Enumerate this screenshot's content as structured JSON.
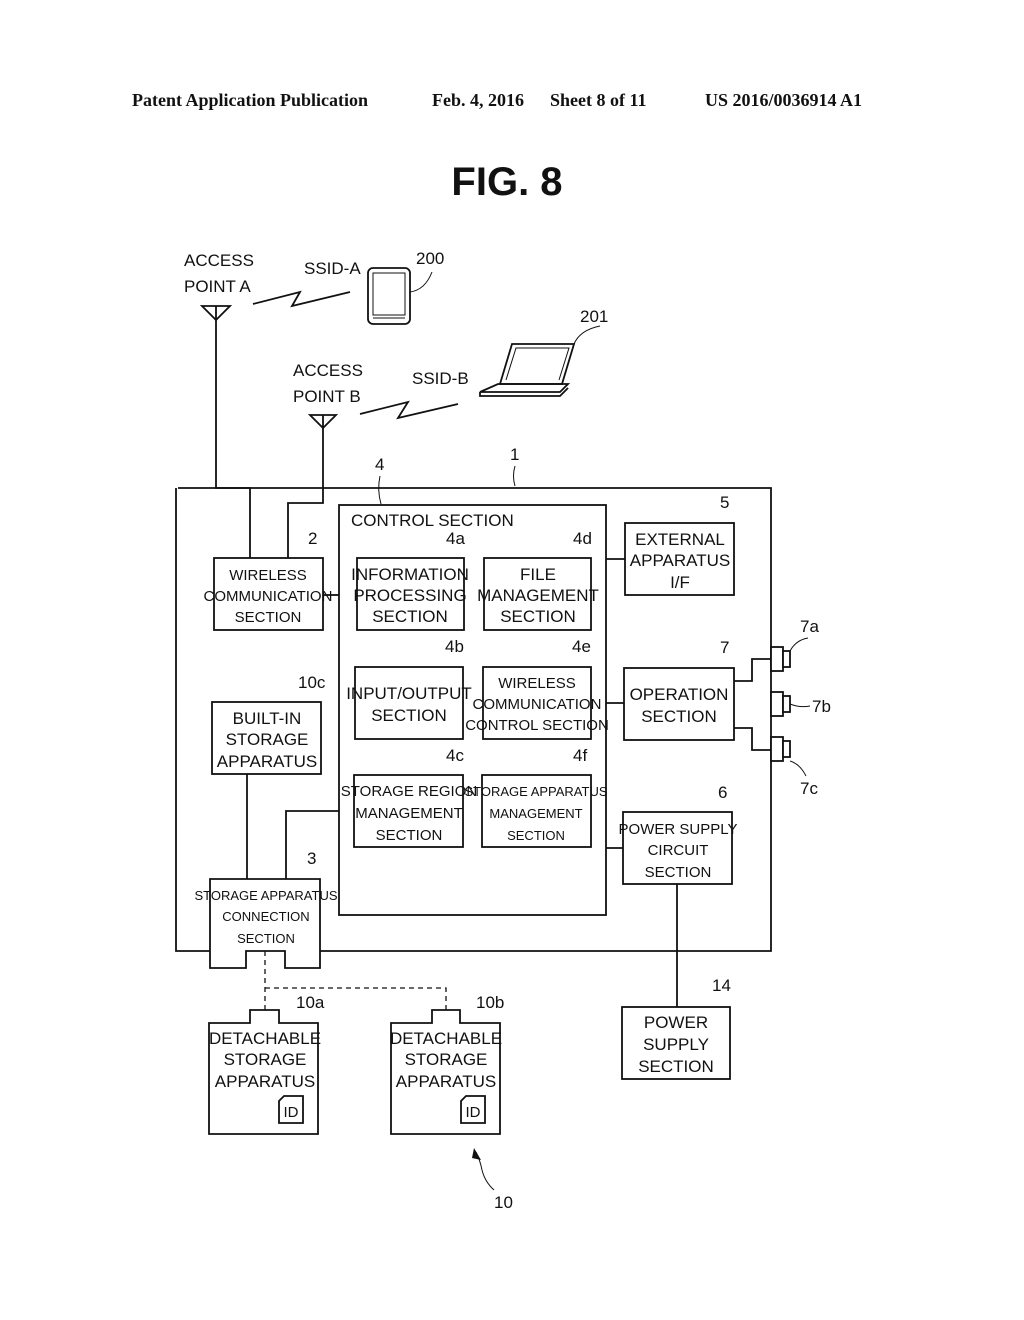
{
  "header": {
    "publication": "Patent Application Publication",
    "date": "Feb. 4, 2016",
    "sheet": "Sheet 8 of 11",
    "patent_number": "US 2016/0036914 A1"
  },
  "figure_title": "FIG. 8",
  "external": {
    "access_point_a": [
      "ACCESS",
      "POINT A"
    ],
    "access_point_b": [
      "ACCESS",
      "POINT B"
    ],
    "ssid_a": "SSID-A",
    "ssid_b": "SSID-B",
    "tablet_ref": "200",
    "laptop_ref": "201"
  },
  "device": {
    "ref": "1",
    "control_section": {
      "ref": "4",
      "title": "CONTROL SECTION",
      "blocks": [
        {
          "ref": "4a",
          "lines": [
            "INFORMATION",
            "PROCESSING",
            "SECTION"
          ]
        },
        {
          "ref": "4d",
          "lines": [
            "FILE",
            "MANAGEMENT",
            "SECTION"
          ]
        },
        {
          "ref": "4b",
          "lines": [
            "INPUT/OUTPUT",
            "SECTION"
          ]
        },
        {
          "ref": "4e",
          "lines": [
            "WIRELESS",
            "COMMUNICATION",
            "CONTROL SECTION"
          ]
        },
        {
          "ref": "4c",
          "lines": [
            "STORAGE REGION",
            "MANAGEMENT",
            "SECTION"
          ]
        },
        {
          "ref": "4f",
          "lines": [
            "STORAGE APPARATUS",
            "MANAGEMENT",
            "SECTION"
          ]
        }
      ]
    },
    "wireless_comm": {
      "ref": "2",
      "lines": [
        "WIRELESS",
        "COMMUNICATION",
        "SECTION"
      ]
    },
    "built_in_storage": {
      "ref": "10c",
      "lines": [
        "BUILT-IN",
        "STORAGE",
        "APPARATUS"
      ]
    },
    "storage_connection": {
      "ref": "3",
      "lines": [
        "STORAGE APPARATUS",
        "CONNECTION",
        "SECTION"
      ]
    },
    "external_if": {
      "ref": "5",
      "lines": [
        "EXTERNAL",
        "APPARATUS",
        "I/F"
      ]
    },
    "operation": {
      "ref": "7",
      "lines": [
        "OPERATION",
        "SECTION"
      ],
      "buttons": [
        "7a",
        "7b",
        "7c"
      ]
    },
    "power_circuit": {
      "ref": "6",
      "lines": [
        "POWER SUPPLY",
        "CIRCUIT",
        "SECTION"
      ]
    }
  },
  "power_supply": {
    "ref": "14",
    "lines": [
      "POWER",
      "SUPPLY",
      "SECTION"
    ]
  },
  "detachable": {
    "group_ref": "10",
    "items": [
      {
        "ref": "10a",
        "lines": [
          "DETACHABLE",
          "STORAGE",
          "APPARATUS"
        ],
        "id_label": "ID"
      },
      {
        "ref": "10b",
        "lines": [
          "DETACHABLE",
          "STORAGE",
          "APPARATUS"
        ],
        "id_label": "ID"
      }
    ]
  }
}
